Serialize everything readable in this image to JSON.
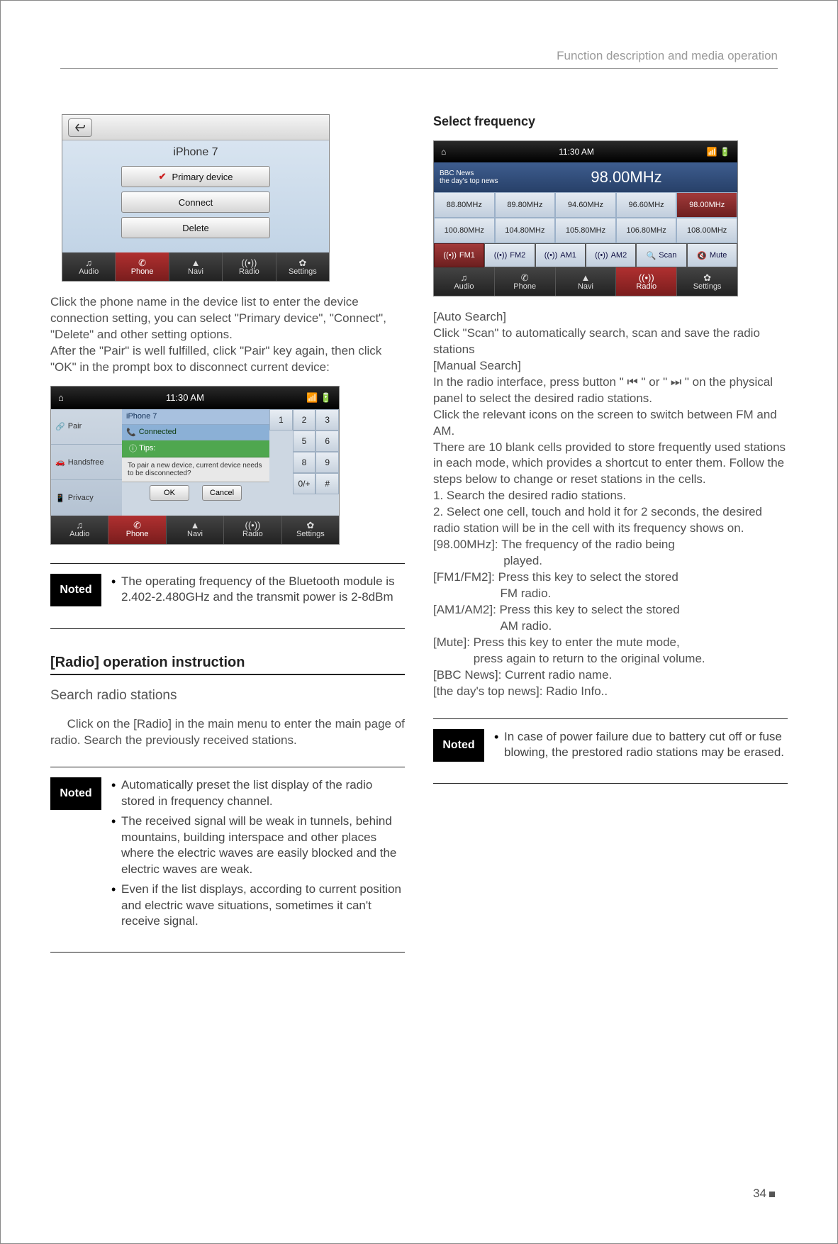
{
  "header": "Function description and media operation",
  "page_num": "34",
  "shot1": {
    "device": "iPhone 7",
    "btn_primary": "Primary device",
    "btn_connect": "Connect",
    "btn_delete": "Delete",
    "nav": {
      "audio": "Audio",
      "phone": "Phone",
      "navi": "Navi",
      "radio": "Radio",
      "settings": "Settings"
    }
  },
  "left_para1": "Click the phone name in the device list to enter the device connection setting, you can select \"Primary device\", \"Connect\", \"Delete\" and other setting options.\nAfter the \"Pair\" is well fulfilled, click \"Pair\" key again, then click \"OK\" in the prompt box to disconnect current device:",
  "shot2": {
    "time": "11:30 AM",
    "left": {
      "pair": "Pair",
      "handsfree": "Handsfree",
      "privacy": "Privacy"
    },
    "iphone": "iPhone 7",
    "connected": "Connected",
    "tips": "Tips:",
    "prompt": "To pair a new device, current device needs to be disconnected?",
    "ok": "OK",
    "cancel": "Cancel",
    "keys": [
      "1",
      "2",
      "3",
      "",
      "5",
      "6",
      "",
      "",
      "",
      "8",
      "9",
      "",
      "0/+",
      "#",
      ""
    ]
  },
  "noted1": "The operating frequency of the Bluetooth module is 2.402-2.480GHz and the transmit power is 2-8dBm",
  "sec_title": "[Radio] operation instruction",
  "sub_title": "Search radio stations",
  "left_para2": "     Click on the [Radio] in the main menu to enter the main page of radio. Search the previously received stations.",
  "noted2": {
    "a": "Automatically preset the list display of the radio stored in frequency channel.",
    "b": "The received signal will be weak in tunnels, behind mountains, building interspace and other places where the electric waves are easily blocked and the electric waves are weak.",
    "c": "Even if the list displays, according to current position and electric wave situations, sometimes it can't receive signal."
  },
  "right_h": "Select frequency",
  "shot3": {
    "time": "11:30 AM",
    "bbc": "BBC News",
    "sub": "the day's top news",
    "freq": "98.00MHz",
    "cells": [
      "88.80MHz",
      "89.80MHz",
      "94.60MHz",
      "96.60MHz",
      "98.00MHz",
      "100.80MHz",
      "104.80MHz",
      "105.80MHz",
      "106.80MHz",
      "108.00MHz"
    ],
    "bands": {
      "fm1": "FM1",
      "fm2": "FM2",
      "am1": "AM1",
      "am2": "AM2",
      "scan": "Scan",
      "mute": "Mute"
    },
    "nav": {
      "audio": "Audio",
      "phone": "Phone",
      "navi": "Navi",
      "radio": "Radio",
      "settings": "Settings"
    }
  },
  "right_body": "[Auto Search]\nClick \"Scan\" to automatically search, scan and save the radio stations\n[Manual Search]\nIn the radio interface, press button \" ⏮ \" or \" ⏭ \" on the physical panel to select the desired radio stations.\nClick the relevant icons on the screen to switch between FM and AM.\nThere are 10 blank cells provided to store frequently used stations in each mode, which provides a shortcut to enter them. Follow the steps below to change or reset stations in the cells.\n1. Search the desired radio stations.\n2. Select one cell, touch and hold it for 2 seconds, the desired radio station will be in the cell with its frequency shows on.\n[98.00MHz]: The frequency of the radio being\n                     played.\n[FM1/FM2]: Press this key to select the stored\n                    FM radio.\n[AM1/AM2]: Press this key to select the stored\n                    AM radio.\n[Mute]: Press this key to enter the mute mode,\n            press again to return to the original volume.\n[BBC News]: Current radio name.\n[the day's top news]: Radio Info..",
  "noted3": "In case of power failure due to battery cut off or fuse blowing, the prestored radio stations may be erased.",
  "noted_label": "Noted"
}
